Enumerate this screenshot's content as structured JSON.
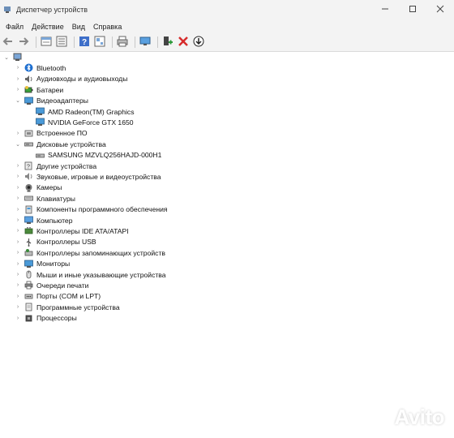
{
  "window": {
    "title": "Диспетчер устройств",
    "controls": [
      "minimize-icon",
      "maximize-icon",
      "close-icon"
    ]
  },
  "menu": [
    "Файл",
    "Действие",
    "Вид",
    "Справка"
  ],
  "toolbar": [
    "back-icon",
    "forward-icon",
    "properties-icon",
    "device-list-icon",
    "help-icon",
    "view-icon",
    "print-icon",
    "monitor-icon",
    "update-driver-icon",
    "uninstall-icon",
    "download-icon"
  ],
  "tree": {
    "root_label": "",
    "categories": [
      {
        "label": "Bluetooth",
        "icon": "bluetooth-icon",
        "expanded": false,
        "children": []
      },
      {
        "label": "Аудиовходы и аудиовыходы",
        "icon": "audio-icon",
        "expanded": false,
        "children": []
      },
      {
        "label": "Батареи",
        "icon": "battery-icon",
        "expanded": false,
        "children": []
      },
      {
        "label": "Видеоадаптеры",
        "icon": "display-adapter-icon",
        "expanded": true,
        "children": [
          {
            "label": "AMD Radeon(TM) Graphics",
            "icon": "display-adapter-icon"
          },
          {
            "label": "NVIDIA GeForce GTX 1650",
            "icon": "display-adapter-icon"
          }
        ]
      },
      {
        "label": "Встроенное ПО",
        "icon": "firmware-icon",
        "expanded": false,
        "children": []
      },
      {
        "label": "Дисковые устройства",
        "icon": "disk-icon",
        "expanded": true,
        "children": [
          {
            "label": "SAMSUNG MZVLQ256HAJD-000H1",
            "icon": "disk-icon"
          }
        ]
      },
      {
        "label": "Другие устройства",
        "icon": "unknown-device-icon",
        "expanded": false,
        "children": []
      },
      {
        "label": "Звуковые, игровые и видеоустройства",
        "icon": "sound-icon",
        "expanded": false,
        "children": []
      },
      {
        "label": "Камеры",
        "icon": "camera-icon",
        "expanded": false,
        "children": []
      },
      {
        "label": "Клавиатуры",
        "icon": "keyboard-icon",
        "expanded": false,
        "children": []
      },
      {
        "label": "Компоненты программного обеспечения",
        "icon": "software-component-icon",
        "expanded": false,
        "children": []
      },
      {
        "label": "Компьютер",
        "icon": "computer-icon",
        "expanded": false,
        "children": []
      },
      {
        "label": "Контроллеры IDE ATA/ATAPI",
        "icon": "ide-controller-icon",
        "expanded": false,
        "children": []
      },
      {
        "label": "Контроллеры USB",
        "icon": "usb-icon",
        "expanded": false,
        "children": []
      },
      {
        "label": "Контроллеры запоминающих устройств",
        "icon": "storage-controller-icon",
        "expanded": false,
        "children": []
      },
      {
        "label": "Мониторы",
        "icon": "monitor-icon",
        "expanded": false,
        "children": []
      },
      {
        "label": "Мыши и иные указывающие устройства",
        "icon": "mouse-icon",
        "expanded": false,
        "children": []
      },
      {
        "label": "Очереди печати",
        "icon": "printer-icon",
        "expanded": false,
        "children": []
      },
      {
        "label": "Порты (COM и LPT)",
        "icon": "port-icon",
        "expanded": false,
        "children": []
      },
      {
        "label": "Программные устройства",
        "icon": "software-device-icon",
        "expanded": false,
        "children": []
      },
      {
        "label": "Процессоры",
        "icon": "processor-icon",
        "expanded": false,
        "children": []
      }
    ]
  },
  "watermark": {
    "text": "Avito"
  },
  "colors": {
    "chrome": "#f3f3f3",
    "accent_blue": "#1e7bd6",
    "uninstall_red": "#d62b2b",
    "update_green": "#2d9a3b"
  }
}
